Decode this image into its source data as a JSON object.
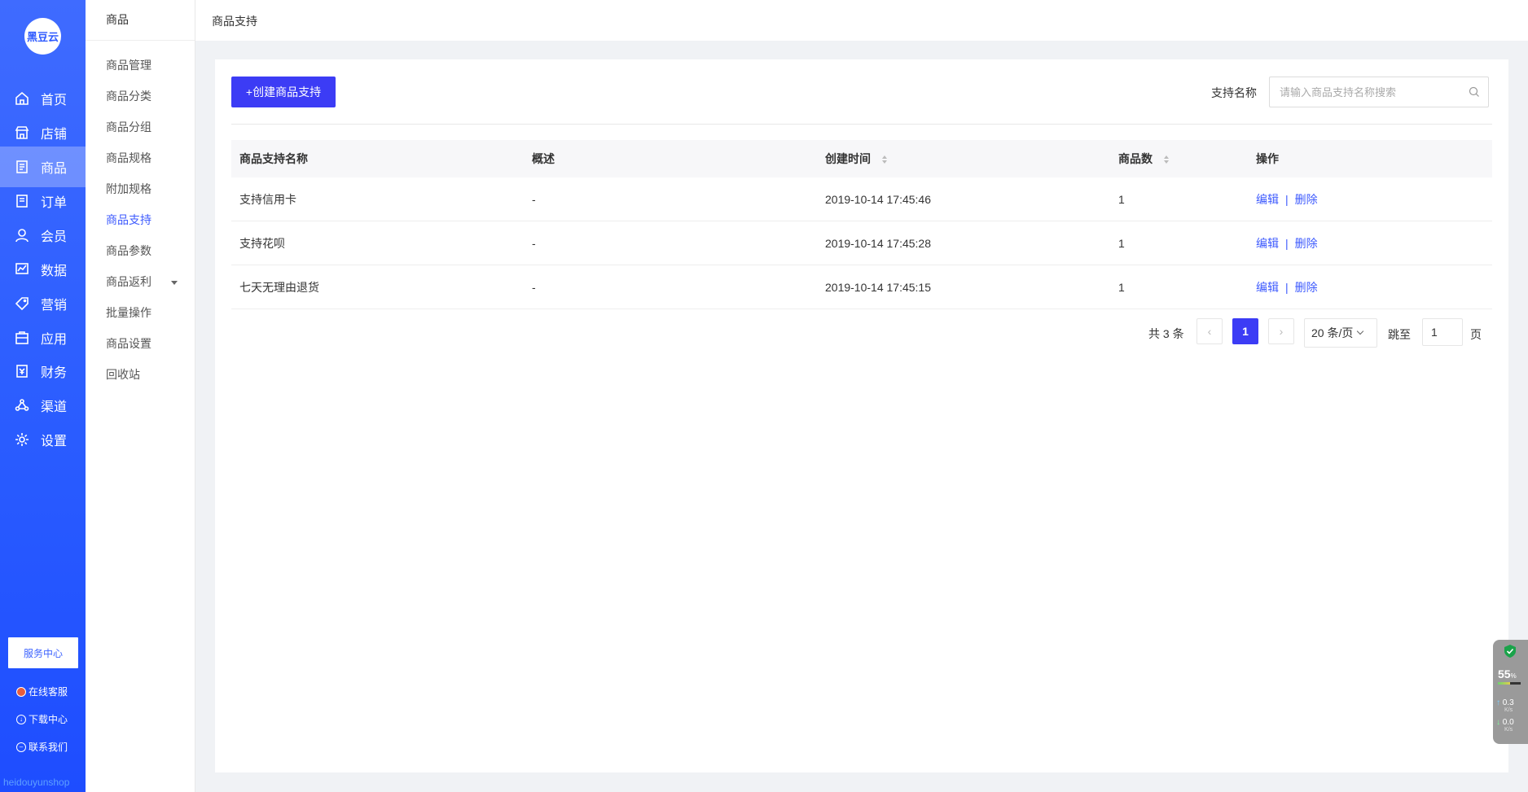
{
  "brand": {
    "logo_text": "黑豆云",
    "footer": "heidouyunshop"
  },
  "main_nav": [
    {
      "label": "首页",
      "icon": "home-icon"
    },
    {
      "label": "店铺",
      "icon": "shop-icon"
    },
    {
      "label": "商品",
      "icon": "goods-icon",
      "active": true
    },
    {
      "label": "订单",
      "icon": "order-icon"
    },
    {
      "label": "会员",
      "icon": "member-icon"
    },
    {
      "label": "数据",
      "icon": "chart-icon"
    },
    {
      "label": "营销",
      "icon": "tag-icon"
    },
    {
      "label": "应用",
      "icon": "app-icon"
    },
    {
      "label": "财务",
      "icon": "finance-icon"
    },
    {
      "label": "渠道",
      "icon": "channel-icon"
    },
    {
      "label": "设置",
      "icon": "gear-icon"
    }
  ],
  "aux": {
    "service_center": "服务中心",
    "online_service": "在线客服",
    "download_center": "下载中心",
    "contact_us": "联系我们"
  },
  "sub_nav": {
    "title": "商品",
    "items": [
      "商品管理",
      "商品分类",
      "商品分组",
      "商品规格",
      "附加规格",
      "商品支持",
      "商品参数",
      "商品返利",
      "批量操作",
      "商品设置",
      "回收站"
    ],
    "active": "商品支持"
  },
  "breadcrumb": "商品支持",
  "toolbar": {
    "create_label": "+创建商品支持",
    "search_label": "支持名称",
    "search_placeholder": "请输入商品支持名称搜索",
    "search_value": ""
  },
  "table": {
    "headers": [
      "商品支持名称",
      "概述",
      "创建时间",
      "商品数",
      "操作"
    ],
    "rows": [
      {
        "name": "支持信用卡",
        "desc": "-",
        "created": "2019-10-14 17:45:46",
        "count": "1"
      },
      {
        "name": "支持花呗",
        "desc": "-",
        "created": "2019-10-14 17:45:28",
        "count": "1"
      },
      {
        "name": "七天无理由退货",
        "desc": "-",
        "created": "2019-10-14 17:45:15",
        "count": "1"
      }
    ],
    "actions": {
      "edit": "编辑",
      "sep": "|",
      "delete": "删除"
    }
  },
  "pagination": {
    "total": "共 3 条",
    "prev": "‹",
    "current": "1",
    "next": "›",
    "page_size": "20 条/页",
    "jump_label": "跳至",
    "jump_value": "1",
    "page_suffix": "页"
  },
  "widget": {
    "percent": "55",
    "percent_unit": "%",
    "up": "0.3",
    "down": "0.0",
    "unit": "K/s",
    "up_arrow": "↑",
    "down_arrow": "↓"
  }
}
